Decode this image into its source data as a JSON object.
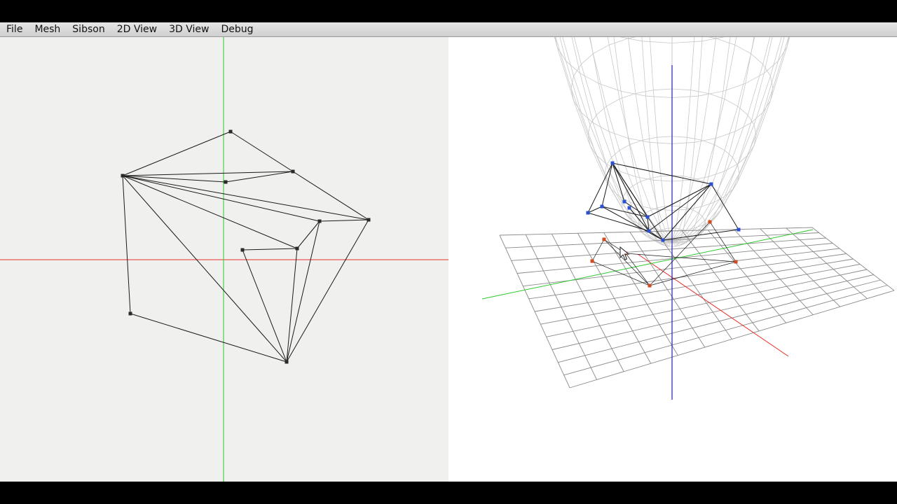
{
  "menu": {
    "items": [
      {
        "id": "file",
        "label": "File"
      },
      {
        "id": "mesh",
        "label": "Mesh"
      },
      {
        "id": "sibson",
        "label": "Sibson"
      },
      {
        "id": "2d-view",
        "label": "2D View"
      },
      {
        "id": "3d-view",
        "label": "3D View"
      },
      {
        "id": "debug",
        "label": "Debug"
      }
    ]
  },
  "colors": {
    "x_axis": "#e8302a",
    "y_axis": "#2ec82e",
    "z_axis": "#2020b0",
    "mesh_edge": "#1a1a1a",
    "surface_wire": "#c8c8c8",
    "ground_grid": "#8a8a8a",
    "vertex_3d_lifted": "#2a4fd0",
    "vertex_3d_projected": "#d24a20"
  },
  "icons": {
    "cursor": "mouse-pointer-icon"
  }
}
